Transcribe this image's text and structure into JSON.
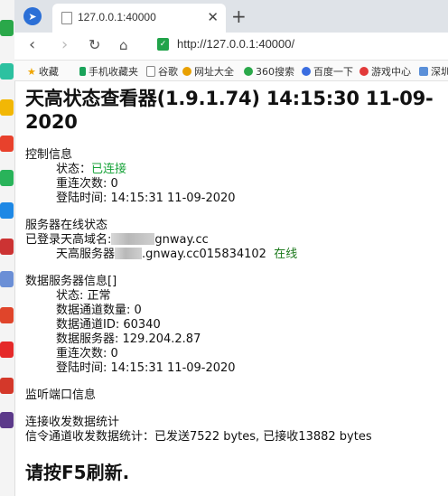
{
  "browser": {
    "tab_title": "127.0.0.1:40000",
    "close_glyph": "✕",
    "new_tab_glyph": "+",
    "url": "http://127.0.0.1:40000/",
    "bookmarks": [
      {
        "label": "收藏",
        "icon": "star-icon",
        "color": "#f0a500"
      },
      {
        "label": "手机收藏夹",
        "icon": "phone-icon",
        "color": "#1aa35a"
      },
      {
        "label": "谷歌",
        "icon": "page-icon",
        "color": "#888888"
      },
      {
        "label": "网址大全",
        "icon": "globe-icon",
        "color": "#e8a000"
      },
      {
        "label": "360搜索",
        "icon": "search-360-icon",
        "color": "#2aa84a"
      },
      {
        "label": "百度一下",
        "icon": "baidu-icon",
        "color": "#3a6de0"
      },
      {
        "label": "游戏中心",
        "icon": "game-icon",
        "color": "#e23a3a"
      },
      {
        "label": "深圳",
        "icon": "bookmark-icon",
        "color": "#5a8fd8"
      }
    ]
  },
  "page": {
    "title": "天高状态查看器(1.9.1.74)  14:15:30 11-09-2020",
    "control": {
      "heading": "控制信息",
      "status_label": "状态：",
      "status_value": "已连接",
      "retry": "重连次数: 0",
      "login": "登陆时间: 14:15:31 11-09-2020"
    },
    "server": {
      "heading": "服务器在线状态",
      "domain_prefix": "已登录天高域名:",
      "domain_suffix": "gnway.cc",
      "server_prefix": "天高服务器",
      "server_suffix": ".gnway.cc015834102",
      "online": "在线"
    },
    "data_server": {
      "heading": "数据服务器信息[]",
      "status": "状态: 正常",
      "channel_count": "数据通道数量: 0",
      "channel_id": "数据通道ID: 60340",
      "server": "数据服务器: 129.204.2.87",
      "retry": "重连次数: 0",
      "login": "登陆时间: 14:15:31 11-09-2020"
    },
    "listen": {
      "heading": "监听端口信息"
    },
    "stats": {
      "heading": "连接收发数据统计",
      "signal": "信令通道收发数据统计：已发送7522 bytes, 已接收13882 bytes"
    },
    "refresh": "请按F5刷新."
  }
}
